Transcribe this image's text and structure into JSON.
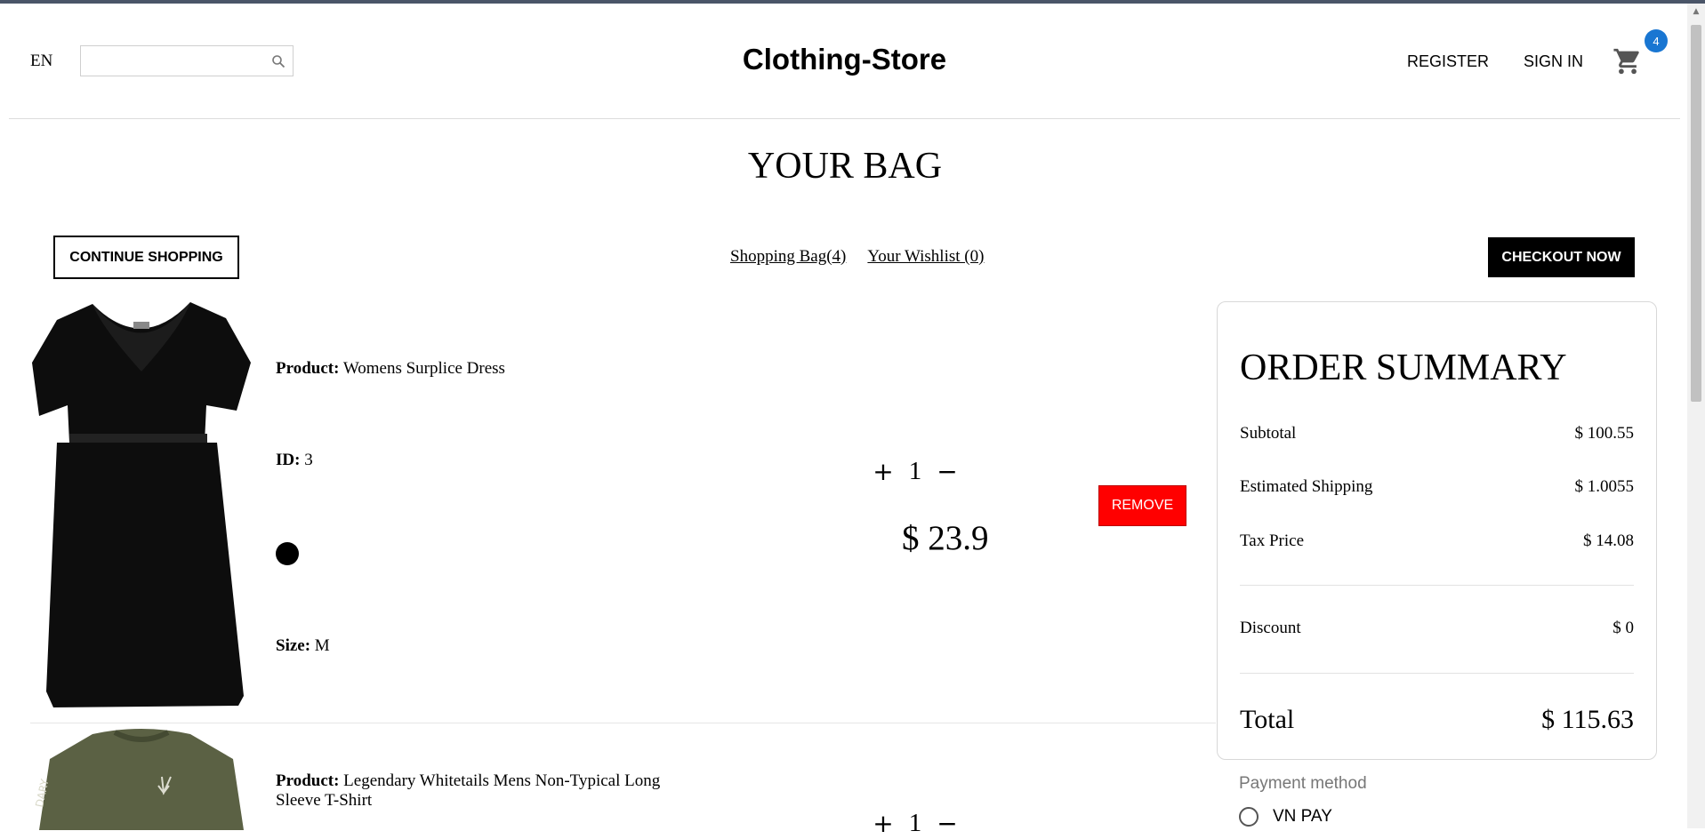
{
  "header": {
    "language": "EN",
    "search": {
      "value": "",
      "placeholder": "",
      "icon": "search-icon"
    },
    "logo": "Clothing-Store",
    "register_label": "REGISTER",
    "signin_label": "SIGN IN",
    "cart": {
      "icon": "cart-icon",
      "count": "4"
    }
  },
  "page": {
    "title": "YOUR BAG",
    "continue_label": "CONTINUE SHOPPING",
    "bag_link": "Shopping Bag(4)",
    "wishlist_link": "Your Wishlist (0)",
    "checkout_label": "CHECKOUT NOW"
  },
  "products": [
    {
      "product_label": "Product:",
      "name": "Womens Surplice Dress",
      "id_label": "ID:",
      "id": "3",
      "color": "#000000",
      "size_label": "Size:",
      "size": "M",
      "qty": "1",
      "plus": "+",
      "minus": "−",
      "price": "$ 23.9",
      "remove_label": "REMOVE"
    },
    {
      "product_label": "Product:",
      "name": "Legendary Whitetails Mens Non-Typical Long Sleeve T-Shirt",
      "qty": "1",
      "plus": "+",
      "minus": "−"
    }
  ],
  "summary": {
    "title": "ORDER SUMMARY",
    "subtotal_label": "Subtotal",
    "subtotal": "$ 100.55",
    "shipping_label": "Estimated Shipping",
    "shipping": "$ 1.0055",
    "tax_label": "Tax Price",
    "tax": "$ 14.08",
    "discount_label": "Discount",
    "discount": "$ 0",
    "total_label": "Total",
    "total": "$ 115.63"
  },
  "payment": {
    "label": "Payment method",
    "options": [
      "VN PAY"
    ]
  },
  "colors": {
    "remove": "#ff0000",
    "badge": "#1976d2",
    "checkout": "#000000"
  }
}
